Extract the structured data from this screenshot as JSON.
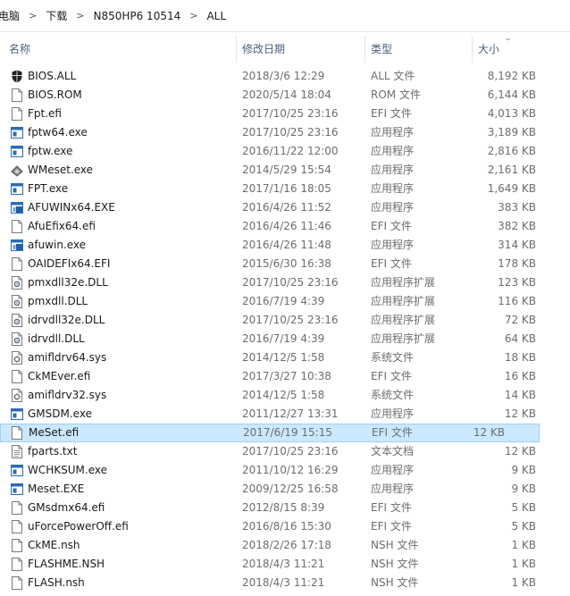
{
  "breadcrumb": [
    "电脑",
    "下载",
    "N850HP6 10514",
    "ALL"
  ],
  "columns": {
    "name": "名称",
    "date": "修改日期",
    "type": "类型",
    "size": "大小"
  },
  "files": [
    {
      "name": "BIOS.ALL",
      "date": "2018/3/6 12:29",
      "type": "ALL 文件",
      "size": "8,192 KB",
      "icon": "shield-file-icon"
    },
    {
      "name": "BIOS.ROM",
      "date": "2020/5/14 18:04",
      "type": "ROM 文件",
      "size": "6,144 KB",
      "icon": "blank-file-icon"
    },
    {
      "name": "Fpt.efi",
      "date": "2017/10/25 23:16",
      "type": "EFI 文件",
      "size": "4,013 KB",
      "icon": "blank-file-icon"
    },
    {
      "name": "fptw64.exe",
      "date": "2017/10/25 23:16",
      "type": "应用程序",
      "size": "3,189 KB",
      "icon": "app-window-icon"
    },
    {
      "name": "fptw.exe",
      "date": "2016/11/22 12:00",
      "type": "应用程序",
      "size": "2,816 KB",
      "icon": "app-window-icon"
    },
    {
      "name": "WMeset.exe",
      "date": "2014/5/29 15:54",
      "type": "应用程序",
      "size": "2,161 KB",
      "icon": "tool-app-icon"
    },
    {
      "name": "FPT.exe",
      "date": "2017/1/16 18:05",
      "type": "应用程序",
      "size": "1,649 KB",
      "icon": "app-window-icon"
    },
    {
      "name": "AFUWINx64.EXE",
      "date": "2016/4/26 11:52",
      "type": "应用程序",
      "size": "383 KB",
      "icon": "afu-app-icon"
    },
    {
      "name": "AfuEfix64.efi",
      "date": "2016/4/26 11:46",
      "type": "EFI 文件",
      "size": "382 KB",
      "icon": "blank-file-icon"
    },
    {
      "name": "afuwin.exe",
      "date": "2016/4/26 11:48",
      "type": "应用程序",
      "size": "314 KB",
      "icon": "afu-app-icon"
    },
    {
      "name": "OAIDEFIx64.EFI",
      "date": "2015/6/30 16:38",
      "type": "EFI 文件",
      "size": "178 KB",
      "icon": "blank-file-icon"
    },
    {
      "name": "pmxdll32e.DLL",
      "date": "2017/10/25 23:16",
      "type": "应用程序扩展",
      "size": "123 KB",
      "icon": "dll-gear-icon"
    },
    {
      "name": "pmxdll.DLL",
      "date": "2016/7/19 4:39",
      "type": "应用程序扩展",
      "size": "116 KB",
      "icon": "dll-gear-icon"
    },
    {
      "name": "idrvdll32e.DLL",
      "date": "2017/10/25 23:16",
      "type": "应用程序扩展",
      "size": "72 KB",
      "icon": "dll-gear-icon"
    },
    {
      "name": "idrvdll.DLL",
      "date": "2016/7/19 4:39",
      "type": "应用程序扩展",
      "size": "64 KB",
      "icon": "dll-gear-icon"
    },
    {
      "name": "amifldrv64.sys",
      "date": "2014/12/5 1:58",
      "type": "系统文件",
      "size": "18 KB",
      "icon": "sys-gear-icon"
    },
    {
      "name": "CkMEver.efi",
      "date": "2017/3/27 10:38",
      "type": "EFI 文件",
      "size": "16 KB",
      "icon": "blank-file-icon"
    },
    {
      "name": "amifldrv32.sys",
      "date": "2014/12/5 1:58",
      "type": "系统文件",
      "size": "14 KB",
      "icon": "sys-gear-icon"
    },
    {
      "name": "GMSDM.exe",
      "date": "2011/12/27 13:31",
      "type": "应用程序",
      "size": "12 KB",
      "icon": "app-window-icon"
    },
    {
      "name": "MeSet.efi",
      "date": "2017/6/19 15:15",
      "type": "EFI 文件",
      "size": "12 KB",
      "icon": "blank-file-icon",
      "selected": true
    },
    {
      "name": "fparts.txt",
      "date": "2017/10/25 23:16",
      "type": "文本文档",
      "size": "12 KB",
      "icon": "text-file-icon"
    },
    {
      "name": "WCHKSUM.exe",
      "date": "2011/10/12 16:29",
      "type": "应用程序",
      "size": "9 KB",
      "icon": "app-window-icon"
    },
    {
      "name": "Meset.EXE",
      "date": "2009/12/25 16:58",
      "type": "应用程序",
      "size": "9 KB",
      "icon": "app-window-icon"
    },
    {
      "name": "GMsdmx64.efi",
      "date": "2012/8/15 8:39",
      "type": "EFI 文件",
      "size": "5 KB",
      "icon": "blank-file-icon"
    },
    {
      "name": "uForcePowerOff.efi",
      "date": "2016/8/16 15:30",
      "type": "EFI 文件",
      "size": "5 KB",
      "icon": "blank-file-icon"
    },
    {
      "name": "CkME.nsh",
      "date": "2018/2/26 17:18",
      "type": "NSH 文件",
      "size": "1 KB",
      "icon": "blank-file-icon"
    },
    {
      "name": "FLASHME.NSH",
      "date": "2018/4/3 11:21",
      "type": "NSH 文件",
      "size": "1 KB",
      "icon": "blank-file-icon"
    },
    {
      "name": "FLASH.nsh",
      "date": "2018/4/3 11:21",
      "type": "NSH 文件",
      "size": "1 KB",
      "icon": "blank-file-icon"
    }
  ],
  "colors": {
    "selection_bg": "#cce8ff",
    "selection_border": "#99d1ff",
    "header_text": "#4c607a",
    "secondary_text": "#6d6d6d"
  }
}
